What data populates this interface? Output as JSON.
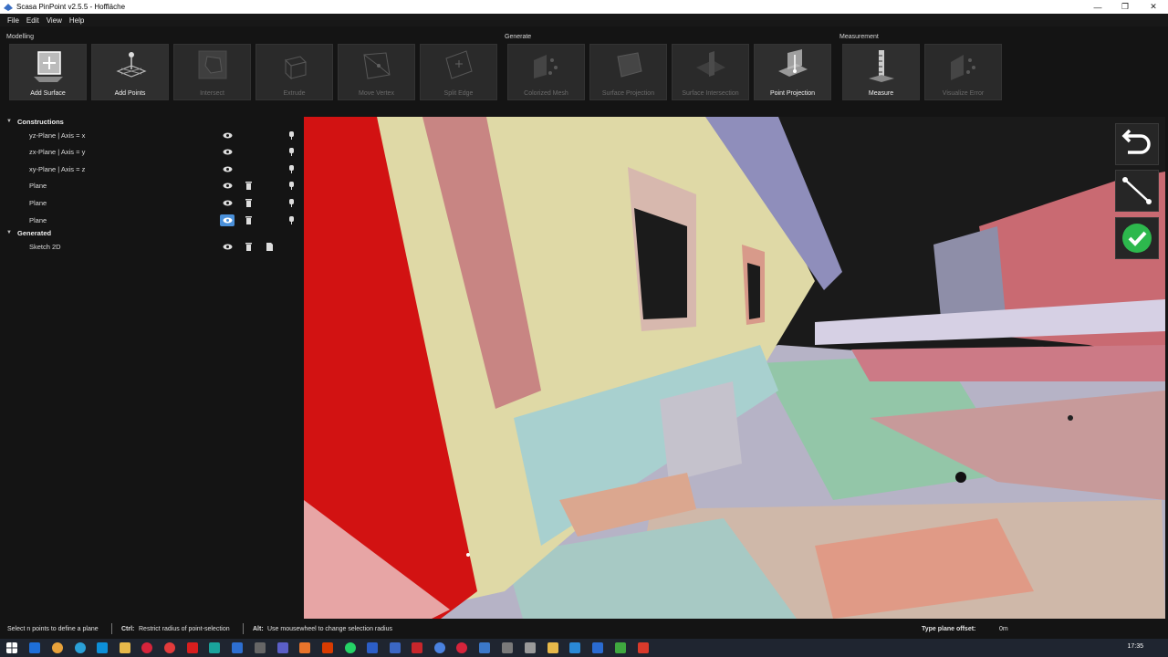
{
  "window": {
    "title": "Scasa PinPoint v2.5.5 - Hoffläche",
    "minimize": "—",
    "maximize": "❐",
    "close": "✕"
  },
  "menu": [
    "File",
    "Edit",
    "View",
    "Help"
  ],
  "ribbon": {
    "groups": {
      "modelling": "Modelling",
      "generate": "Generate",
      "measurement": "Measurement"
    },
    "tools": [
      {
        "label": "Add Surface",
        "icon": "add-surface-icon",
        "enabled": true
      },
      {
        "label": "Add Points",
        "icon": "add-points-icon",
        "enabled": true
      },
      {
        "label": "Intersect",
        "icon": "intersect-icon",
        "enabled": false
      },
      {
        "label": "Extrude",
        "icon": "extrude-icon",
        "enabled": false
      },
      {
        "label": "Move Vertex",
        "icon": "move-vertex-icon",
        "enabled": false
      },
      {
        "label": "Split Edge",
        "icon": "split-edge-icon",
        "enabled": false
      },
      {
        "label": "Colorized Mesh",
        "icon": "colorized-mesh-icon",
        "enabled": false
      },
      {
        "label": "Surface Projection",
        "icon": "surface-projection-icon",
        "enabled": false
      },
      {
        "label": "Surface Intersection",
        "icon": "surface-intersection-icon",
        "enabled": false
      },
      {
        "label": "Point Projection",
        "icon": "point-projection-icon",
        "enabled": true
      },
      {
        "label": "Measure",
        "icon": "measure-icon",
        "enabled": true
      },
      {
        "label": "Visualize Error",
        "icon": "visualize-error-icon",
        "enabled": false
      }
    ]
  },
  "tree": {
    "constructions_label": "Constructions",
    "generated_label": "Generated",
    "constructions": [
      {
        "label": "yz-Plane | Axis = x",
        "visible_active": false,
        "deletable": false
      },
      {
        "label": "zx-Plane | Axis = y",
        "visible_active": false,
        "deletable": false
      },
      {
        "label": "xy-Plane | Axis = z",
        "visible_active": false,
        "deletable": false
      },
      {
        "label": "Plane",
        "visible_active": false,
        "deletable": true
      },
      {
        "label": "Plane",
        "visible_active": false,
        "deletable": true
      },
      {
        "label": "Plane",
        "visible_active": true,
        "deletable": true
      }
    ],
    "generated": [
      {
        "label": "Sketch 2D"
      }
    ]
  },
  "viewport_buttons": [
    "undo-icon",
    "line-segment-icon",
    "confirm-check-icon"
  ],
  "status": {
    "hint": "Select n points to define a plane",
    "ctrl_key": "Ctrl:",
    "ctrl_text": "Restrict radius of point-selection",
    "alt_key": "Alt:",
    "alt_text": "Use mousewheel to change selection radius",
    "offset_label": "Type plane offset:",
    "offset_value": "0m"
  },
  "taskbar": {
    "clock": "17:35"
  },
  "colors": {
    "accent": "#4a90d9",
    "confirm": "#2db84d",
    "background": "#141414"
  }
}
